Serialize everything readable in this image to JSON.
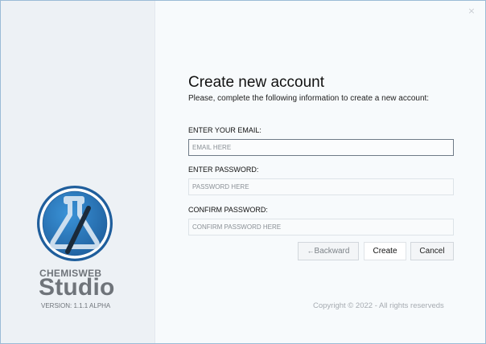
{
  "window": {
    "close_glyph": "×"
  },
  "brand": {
    "name_small": "CHEMISWEB",
    "name_big": "Studio",
    "version": "VERSION: 1.1.1 ALPHA",
    "logo_colors": {
      "outer": "#1f5e9c",
      "inner": "#2b82cc",
      "ring": "#ffffff",
      "flask": "#d9e6f2",
      "slash": "#1a2a3a"
    }
  },
  "form": {
    "title": "Create new account",
    "subtitle": "Please, complete the following information to create a new account:",
    "email_label": "ENTER YOUR EMAIL:",
    "email_placeholder": "EMAIL HERE",
    "password_label": "ENTER PASSWORD:",
    "password_placeholder": "PASSWORD HERE",
    "confirm_label": "CONFIRM PASSWORD:",
    "confirm_placeholder": "CONFIRM PASSWORD HERE"
  },
  "buttons": {
    "backward_arrow": "←",
    "backward_label": "Backward",
    "create_label": "Create",
    "cancel_label": "Cancel"
  },
  "footer": {
    "copyright": "Copyright © 2022 - All rights reserveds"
  }
}
